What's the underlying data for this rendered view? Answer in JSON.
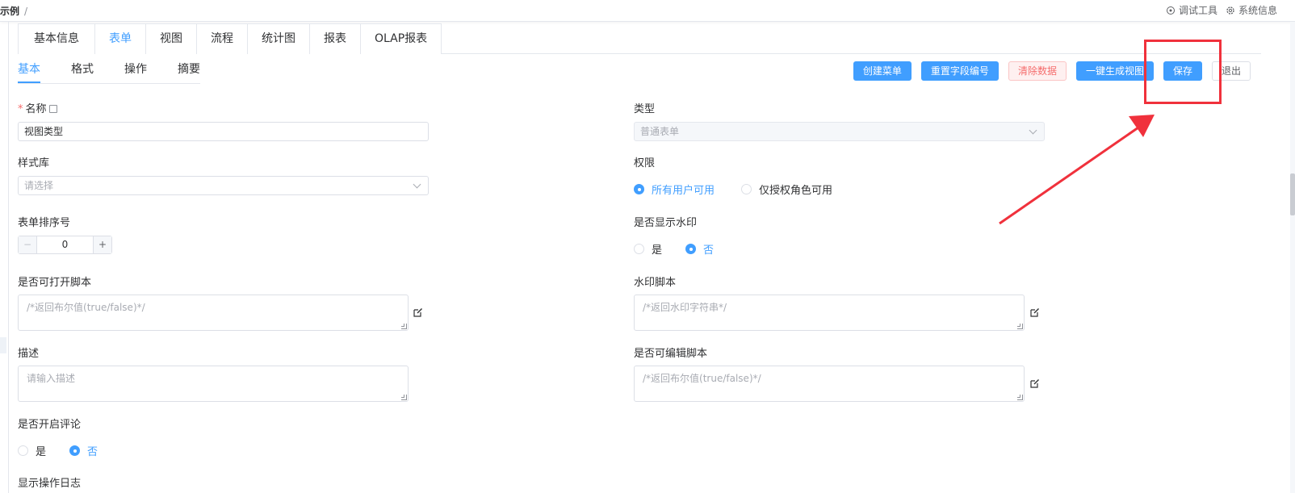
{
  "breadcrumb": {
    "text": "示例",
    "separator": "/"
  },
  "top_actions": {
    "debug": "调试工具",
    "sysinfo": "系统信息"
  },
  "main_tabs": [
    "基本信息",
    "表单",
    "视图",
    "流程",
    "统计图",
    "报表",
    "OLAP报表"
  ],
  "main_tab_active": "表单",
  "sub_tabs": [
    "基本",
    "格式",
    "操作",
    "摘要"
  ],
  "sub_tab_active": "基本",
  "buttons": {
    "create_menu": "创建菜单",
    "reset_field_no": "重置字段编号",
    "clear_data": "清除数据",
    "gen_view": "一键生成视图",
    "save": "保存",
    "exit": "退出"
  },
  "form": {
    "name_label": "名称",
    "name_value": "视图类型",
    "type_label": "类型",
    "type_value": "普通表单",
    "style_label": "样式库",
    "style_placeholder": "请选择",
    "perm_label": "权限",
    "perm_opt1": "所有用户可用",
    "perm_opt2": "仅授权角色可用",
    "perm_selected": "所有用户可用",
    "sort_label": "表单排序号",
    "sort_value": "0",
    "watermark_label": "是否显示水印",
    "yes": "是",
    "no": "否",
    "watermark_selected": "否",
    "open_script_label": "是否可打开脚本",
    "open_script_placeholder": "/*返回布尔值(true/false)*/",
    "watermark_script_label": "水印脚本",
    "watermark_script_placeholder": "/*返回水印字符串*/",
    "desc_label": "描述",
    "desc_placeholder": "请输入描述",
    "edit_script_label": "是否可编辑脚本",
    "edit_script_placeholder": "/*返回布尔值(true/false)*/",
    "comment_label": "是否开启评论",
    "comment_selected": "否",
    "oplog_label": "显示操作日志"
  },
  "colors": {
    "primary": "#409eff",
    "annotation": "#f0313c",
    "danger": "#f56c6c"
  }
}
